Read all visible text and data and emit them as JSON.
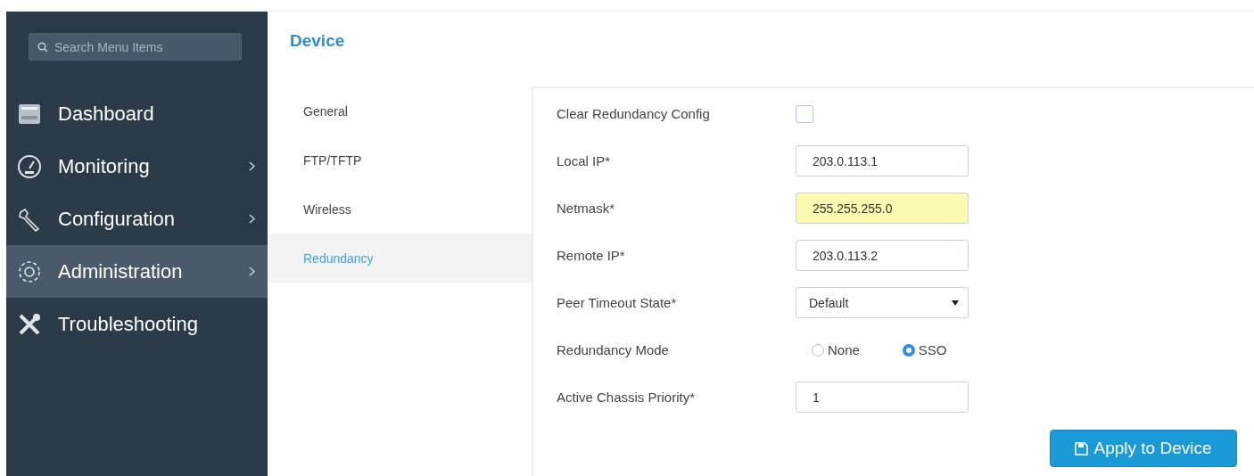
{
  "sidebar": {
    "search": {
      "placeholder": "Search Menu Items"
    },
    "items": [
      {
        "label": "Dashboard",
        "has_submenu": false,
        "selected": false
      },
      {
        "label": "Monitoring",
        "has_submenu": true,
        "selected": false
      },
      {
        "label": "Configuration",
        "has_submenu": true,
        "selected": false
      },
      {
        "label": "Administration",
        "has_submenu": true,
        "selected": true
      },
      {
        "label": "Troubleshooting",
        "has_submenu": false,
        "selected": false
      }
    ]
  },
  "page": {
    "title": "Device"
  },
  "subnav": [
    {
      "label": "General",
      "selected": false
    },
    {
      "label": "FTP/TFTP",
      "selected": false
    },
    {
      "label": "Wireless",
      "selected": false
    },
    {
      "label": "Redundancy",
      "selected": true
    }
  ],
  "form": [
    {
      "kind": "checkbox",
      "label": "Clear Redundancy Config",
      "checked": false
    },
    {
      "kind": "text",
      "label": "Local IP*",
      "value": "203.0.113.1",
      "highlighted": false
    },
    {
      "kind": "text",
      "label": "Netmask*",
      "value": "255.255.255.0",
      "highlighted": true
    },
    {
      "kind": "text",
      "label": "Remote IP*",
      "value": "203.0.113.2",
      "highlighted": false
    },
    {
      "kind": "select",
      "label": "Peer Timeout State*",
      "value": "Default"
    },
    {
      "kind": "radio",
      "label": "Redundancy Mode",
      "options": [
        {
          "label": "None",
          "selected": false
        },
        {
          "label": "SSO",
          "selected": true
        }
      ]
    },
    {
      "kind": "text",
      "label": "Active Chassis Priority*",
      "value": "1",
      "highlighted": false
    }
  ],
  "apply_button": {
    "label": "Apply to Device"
  }
}
